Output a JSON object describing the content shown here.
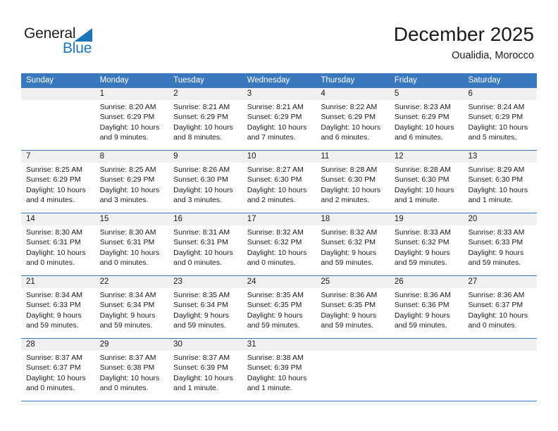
{
  "brand": {
    "name_top": "General",
    "name_bottom": "Blue",
    "triangle_color": "#1b75bb",
    "text_color": "#231f20"
  },
  "header": {
    "title": "December 2025",
    "subtitle": "Oualidia, Morocco"
  },
  "theme": {
    "header_blue": "#3a78bd",
    "day_band_gray": "#f0f0f0",
    "text": "#1a1a1a"
  },
  "weekdays": [
    "Sunday",
    "Monday",
    "Tuesday",
    "Wednesday",
    "Thursday",
    "Friday",
    "Saturday"
  ],
  "weeks": [
    [
      {
        "day": "",
        "empty": true,
        "sunrise": "",
        "sunset": "",
        "daylight1": "",
        "daylight2": ""
      },
      {
        "day": "1",
        "sunrise": "Sunrise: 8:20 AM",
        "sunset": "Sunset: 6:29 PM",
        "daylight1": "Daylight: 10 hours",
        "daylight2": "and 9 minutes."
      },
      {
        "day": "2",
        "sunrise": "Sunrise: 8:21 AM",
        "sunset": "Sunset: 6:29 PM",
        "daylight1": "Daylight: 10 hours",
        "daylight2": "and 8 minutes."
      },
      {
        "day": "3",
        "sunrise": "Sunrise: 8:21 AM",
        "sunset": "Sunset: 6:29 PM",
        "daylight1": "Daylight: 10 hours",
        "daylight2": "and 7 minutes."
      },
      {
        "day": "4",
        "sunrise": "Sunrise: 8:22 AM",
        "sunset": "Sunset: 6:29 PM",
        "daylight1": "Daylight: 10 hours",
        "daylight2": "and 6 minutes."
      },
      {
        "day": "5",
        "sunrise": "Sunrise: 8:23 AM",
        "sunset": "Sunset: 6:29 PM",
        "daylight1": "Daylight: 10 hours",
        "daylight2": "and 6 minutes."
      },
      {
        "day": "6",
        "sunrise": "Sunrise: 8:24 AM",
        "sunset": "Sunset: 6:29 PM",
        "daylight1": "Daylight: 10 hours",
        "daylight2": "and 5 minutes."
      }
    ],
    [
      {
        "day": "7",
        "sunrise": "Sunrise: 8:25 AM",
        "sunset": "Sunset: 6:29 PM",
        "daylight1": "Daylight: 10 hours",
        "daylight2": "and 4 minutes."
      },
      {
        "day": "8",
        "sunrise": "Sunrise: 8:25 AM",
        "sunset": "Sunset: 6:29 PM",
        "daylight1": "Daylight: 10 hours",
        "daylight2": "and 3 minutes."
      },
      {
        "day": "9",
        "sunrise": "Sunrise: 8:26 AM",
        "sunset": "Sunset: 6:30 PM",
        "daylight1": "Daylight: 10 hours",
        "daylight2": "and 3 minutes."
      },
      {
        "day": "10",
        "sunrise": "Sunrise: 8:27 AM",
        "sunset": "Sunset: 6:30 PM",
        "daylight1": "Daylight: 10 hours",
        "daylight2": "and 2 minutes."
      },
      {
        "day": "11",
        "sunrise": "Sunrise: 8:28 AM",
        "sunset": "Sunset: 6:30 PM",
        "daylight1": "Daylight: 10 hours",
        "daylight2": "and 2 minutes."
      },
      {
        "day": "12",
        "sunrise": "Sunrise: 8:28 AM",
        "sunset": "Sunset: 6:30 PM",
        "daylight1": "Daylight: 10 hours",
        "daylight2": "and 1 minute."
      },
      {
        "day": "13",
        "sunrise": "Sunrise: 8:29 AM",
        "sunset": "Sunset: 6:30 PM",
        "daylight1": "Daylight: 10 hours",
        "daylight2": "and 1 minute."
      }
    ],
    [
      {
        "day": "14",
        "sunrise": "Sunrise: 8:30 AM",
        "sunset": "Sunset: 6:31 PM",
        "daylight1": "Daylight: 10 hours",
        "daylight2": "and 0 minutes."
      },
      {
        "day": "15",
        "sunrise": "Sunrise: 8:30 AM",
        "sunset": "Sunset: 6:31 PM",
        "daylight1": "Daylight: 10 hours",
        "daylight2": "and 0 minutes."
      },
      {
        "day": "16",
        "sunrise": "Sunrise: 8:31 AM",
        "sunset": "Sunset: 6:31 PM",
        "daylight1": "Daylight: 10 hours",
        "daylight2": "and 0 minutes."
      },
      {
        "day": "17",
        "sunrise": "Sunrise: 8:32 AM",
        "sunset": "Sunset: 6:32 PM",
        "daylight1": "Daylight: 10 hours",
        "daylight2": "and 0 minutes."
      },
      {
        "day": "18",
        "sunrise": "Sunrise: 8:32 AM",
        "sunset": "Sunset: 6:32 PM",
        "daylight1": "Daylight: 9 hours",
        "daylight2": "and 59 minutes."
      },
      {
        "day": "19",
        "sunrise": "Sunrise: 8:33 AM",
        "sunset": "Sunset: 6:32 PM",
        "daylight1": "Daylight: 9 hours",
        "daylight2": "and 59 minutes."
      },
      {
        "day": "20",
        "sunrise": "Sunrise: 8:33 AM",
        "sunset": "Sunset: 6:33 PM",
        "daylight1": "Daylight: 9 hours",
        "daylight2": "and 59 minutes."
      }
    ],
    [
      {
        "day": "21",
        "sunrise": "Sunrise: 8:34 AM",
        "sunset": "Sunset: 6:33 PM",
        "daylight1": "Daylight: 9 hours",
        "daylight2": "and 59 minutes."
      },
      {
        "day": "22",
        "sunrise": "Sunrise: 8:34 AM",
        "sunset": "Sunset: 6:34 PM",
        "daylight1": "Daylight: 9 hours",
        "daylight2": "and 59 minutes."
      },
      {
        "day": "23",
        "sunrise": "Sunrise: 8:35 AM",
        "sunset": "Sunset: 6:34 PM",
        "daylight1": "Daylight: 9 hours",
        "daylight2": "and 59 minutes."
      },
      {
        "day": "24",
        "sunrise": "Sunrise: 8:35 AM",
        "sunset": "Sunset: 6:35 PM",
        "daylight1": "Daylight: 9 hours",
        "daylight2": "and 59 minutes."
      },
      {
        "day": "25",
        "sunrise": "Sunrise: 8:36 AM",
        "sunset": "Sunset: 6:35 PM",
        "daylight1": "Daylight: 9 hours",
        "daylight2": "and 59 minutes."
      },
      {
        "day": "26",
        "sunrise": "Sunrise: 8:36 AM",
        "sunset": "Sunset: 6:36 PM",
        "daylight1": "Daylight: 9 hours",
        "daylight2": "and 59 minutes."
      },
      {
        "day": "27",
        "sunrise": "Sunrise: 8:36 AM",
        "sunset": "Sunset: 6:37 PM",
        "daylight1": "Daylight: 10 hours",
        "daylight2": "and 0 minutes."
      }
    ],
    [
      {
        "day": "28",
        "sunrise": "Sunrise: 8:37 AM",
        "sunset": "Sunset: 6:37 PM",
        "daylight1": "Daylight: 10 hours",
        "daylight2": "and 0 minutes."
      },
      {
        "day": "29",
        "sunrise": "Sunrise: 8:37 AM",
        "sunset": "Sunset: 6:38 PM",
        "daylight1": "Daylight: 10 hours",
        "daylight2": "and 0 minutes."
      },
      {
        "day": "30",
        "sunrise": "Sunrise: 8:37 AM",
        "sunset": "Sunset: 6:39 PM",
        "daylight1": "Daylight: 10 hours",
        "daylight2": "and 1 minute."
      },
      {
        "day": "31",
        "sunrise": "Sunrise: 8:38 AM",
        "sunset": "Sunset: 6:39 PM",
        "daylight1": "Daylight: 10 hours",
        "daylight2": "and 1 minute."
      },
      {
        "day": "",
        "empty": true,
        "sunrise": "",
        "sunset": "",
        "daylight1": "",
        "daylight2": ""
      },
      {
        "day": "",
        "empty": true,
        "sunrise": "",
        "sunset": "",
        "daylight1": "",
        "daylight2": ""
      },
      {
        "day": "",
        "empty": true,
        "sunrise": "",
        "sunset": "",
        "daylight1": "",
        "daylight2": ""
      }
    ]
  ]
}
